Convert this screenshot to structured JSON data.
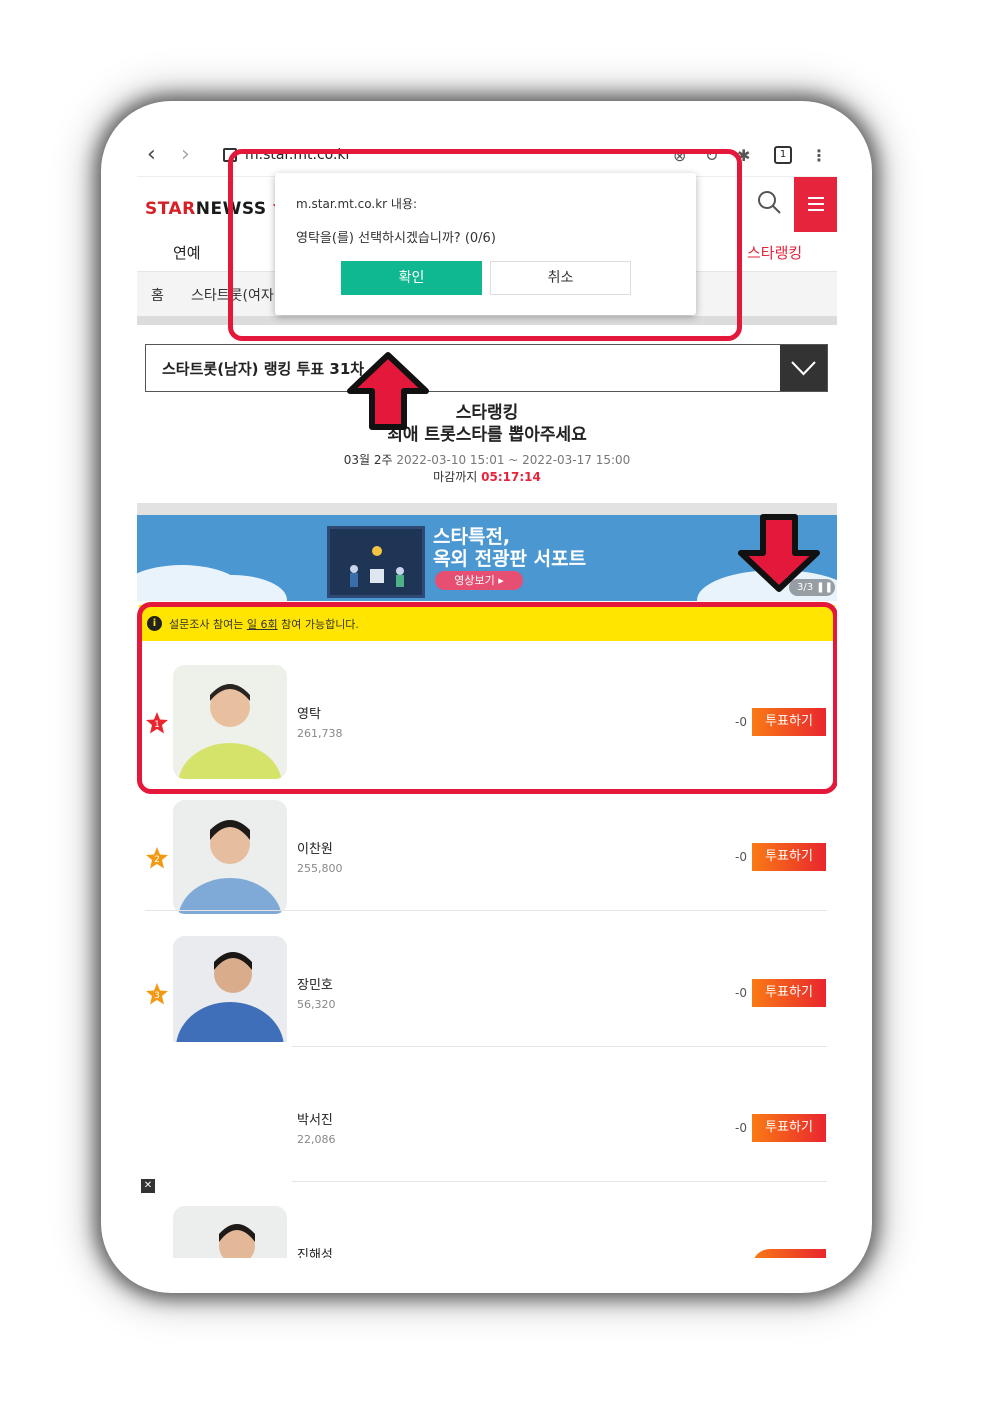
{
  "browser": {
    "url": "m.star.mt.co.kr",
    "tab_count": "1"
  },
  "site": {
    "logo_a": "STAR",
    "logo_b": "NEWS",
    "logo_c": "S",
    "gnb_first": "연예",
    "gnb_active": "스타랭킹",
    "breadcrumb_home": "홈",
    "breadcrumb_current": "스타트롯(여자"
  },
  "dialog": {
    "origin": "m.star.mt.co.kr 내용:",
    "message": "영탁을(를) 선택하시겠습니까? (0/6)",
    "ok_label": "확인",
    "cancel_label": "취소"
  },
  "vote": {
    "selected": "스타트롯(남자) 랭킹 투표 31차",
    "title": "스타랭킹",
    "subtitle": "최애 트롯스타를 뽑아주세요",
    "period_week": "03월 2주",
    "period_range": "2022-03-10 15:01 ~ 2022-03-17 15:00",
    "deadline_label": "마감까지",
    "deadline_time": "05:17:14"
  },
  "banner": {
    "line1": "스타특전,",
    "line2": "옥외 전광판 서포트",
    "button": "영상보기 ▸",
    "counter": "3/3 ❚❚"
  },
  "notice": {
    "prefix": "설문조사 참여는",
    "emph": "일 6회",
    "suffix": "참여 가능합니다."
  },
  "candidates": [
    {
      "rank": "1",
      "name": "영탁",
      "votes": "261,738",
      "delta": "-0",
      "button": "투표하기"
    },
    {
      "rank": "2",
      "name": "이찬원",
      "votes": "255,800",
      "delta": "-0",
      "button": "투표하기"
    },
    {
      "rank": "3",
      "name": "장민호",
      "votes": "56,320",
      "delta": "-0",
      "button": "투표하기"
    },
    {
      "rank": "",
      "name": "박서진",
      "votes": "22,086",
      "delta": "-0",
      "button": "투표하기"
    },
    {
      "rank": "",
      "name": "진해성",
      "votes": "",
      "delta": "",
      "button": ""
    }
  ],
  "colors": {
    "brand_red": "#e6243b",
    "confirm_green": "#10b892",
    "notice_yellow": "#ffe500",
    "annotation_red": "#e4183a"
  }
}
